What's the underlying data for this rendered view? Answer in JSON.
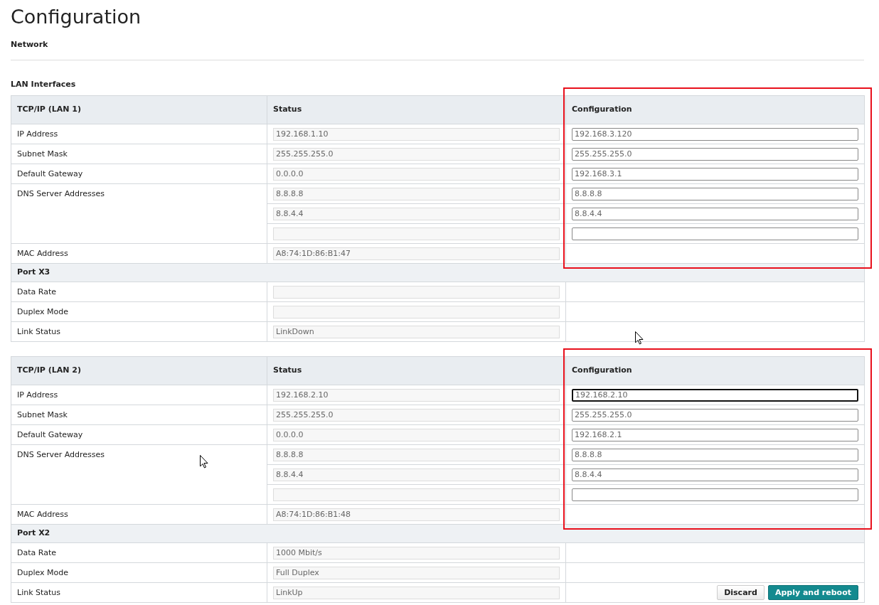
{
  "title": "Configuration",
  "subtitle": "Network",
  "section_title": "LAN Interfaces",
  "tables": [
    {
      "highlighted": true,
      "columns": [
        "TCP/IP (LAN 1)",
        "Status",
        "Configuration"
      ],
      "rows": [
        {
          "kind": "field",
          "label": "IP Address",
          "entries": [
            {
              "status": "192.168.1.10",
              "editable": true,
              "config": "192.168.3.120",
              "focused": false
            }
          ]
        },
        {
          "kind": "field",
          "label": "Subnet Mask",
          "entries": [
            {
              "status": "255.255.255.0",
              "editable": true,
              "config": "255.255.255.0",
              "focused": false
            }
          ]
        },
        {
          "kind": "field",
          "label": "Default Gateway",
          "entries": [
            {
              "status": "0.0.0.0",
              "editable": true,
              "config": "192.168.3.1",
              "focused": false
            }
          ]
        },
        {
          "kind": "field",
          "label": "DNS Server Addresses",
          "entries": [
            {
              "status": "8.8.8.8",
              "editable": true,
              "config": "8.8.8.8",
              "focused": false
            },
            {
              "status": "8.8.4.4",
              "editable": true,
              "config": "8.8.4.4",
              "focused": false
            },
            {
              "editable": true,
              "focused": false
            }
          ]
        },
        {
          "kind": "field",
          "label": "MAC Address",
          "entries": [
            {
              "status": "A8:74:1D:86:B1:47",
              "editable": false
            }
          ]
        },
        {
          "kind": "section",
          "label": "Port X3"
        },
        {
          "kind": "field",
          "label": "Data Rate",
          "entries": [
            {
              "editable": false
            }
          ]
        },
        {
          "kind": "field",
          "label": "Duplex Mode",
          "entries": [
            {
              "editable": false
            }
          ]
        },
        {
          "kind": "field",
          "label": "Link Status",
          "entries": [
            {
              "status": "LinkDown",
              "editable": false
            }
          ]
        }
      ]
    },
    {
      "highlighted": true,
      "columns": [
        "TCP/IP (LAN 2)",
        "Status",
        "Configuration"
      ],
      "rows": [
        {
          "kind": "field",
          "label": "IP Address",
          "entries": [
            {
              "status": "192.168.2.10",
              "editable": true,
              "config": "192.168.2.10",
              "focused": true
            }
          ]
        },
        {
          "kind": "field",
          "label": "Subnet Mask",
          "entries": [
            {
              "status": "255.255.255.0",
              "editable": true,
              "config": "255.255.255.0",
              "focused": false
            }
          ]
        },
        {
          "kind": "field",
          "label": "Default Gateway",
          "entries": [
            {
              "status": "0.0.0.0",
              "editable": true,
              "config": "192.168.2.1",
              "focused": false
            }
          ]
        },
        {
          "kind": "field",
          "label": "DNS Server Addresses",
          "entries": [
            {
              "status": "8.8.8.8",
              "editable": true,
              "config": "8.8.8.8",
              "focused": false
            },
            {
              "status": "8.8.4.4",
              "editable": true,
              "config": "8.8.4.4",
              "focused": false
            },
            {
              "editable": true,
              "focused": false
            }
          ]
        },
        {
          "kind": "field",
          "label": "MAC Address",
          "entries": [
            {
              "status": "A8:74:1D:86:B1:48",
              "editable": false
            }
          ]
        },
        {
          "kind": "section",
          "label": "Port X2"
        },
        {
          "kind": "field",
          "label": "Data Rate",
          "entries": [
            {
              "status": "1000 Mbit/s",
              "editable": false
            }
          ]
        },
        {
          "kind": "field",
          "label": "Duplex Mode",
          "entries": [
            {
              "status": "Full Duplex",
              "editable": false
            }
          ]
        },
        {
          "kind": "field",
          "label": "Link Status",
          "entries": [
            {
              "status": "LinkUp",
              "editable": false
            }
          ]
        }
      ],
      "buttons": [
        {
          "label": "Discard",
          "kind": "secondary"
        },
        {
          "label": "Apply and reboot",
          "kind": "primary"
        }
      ]
    }
  ]
}
